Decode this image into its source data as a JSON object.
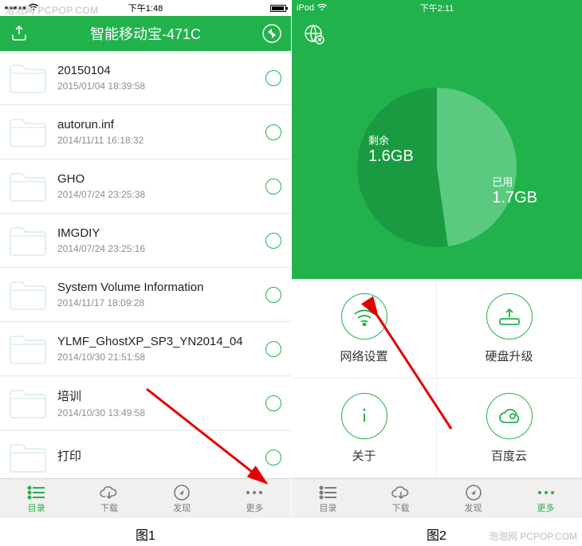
{
  "watermark": "泡泡网 PCPOP.COM",
  "screen1": {
    "status": {
      "carrier_dots": 5,
      "wifi": true,
      "time": "下午1:48",
      "battery": true
    },
    "nav": {
      "title": "智能移动宝-471C",
      "left_icon": "upload-icon",
      "right_icon": "refresh-arrows-icon"
    },
    "files": [
      {
        "name": "20150104",
        "date": "2015/01/04 18:39:58"
      },
      {
        "name": "autorun.inf",
        "date": "2014/11/11 16:18:32"
      },
      {
        "name": "GHO",
        "date": "2014/07/24 23:25:38"
      },
      {
        "name": "IMGDIY",
        "date": "2014/07/24 23:25:16"
      },
      {
        "name": "System Volume Information",
        "date": "2014/11/17 18:09:28"
      },
      {
        "name": "YLMF_GhostXP_SP3_YN2014_04",
        "date": "2014/10/30 21:51:58"
      },
      {
        "name": "培训",
        "date": "2014/10/30 13:49:58"
      },
      {
        "name": "打印",
        "date": ""
      }
    ],
    "tabs": [
      {
        "label": "目录",
        "icon": "list-icon",
        "active": true
      },
      {
        "label": "下载",
        "icon": "cloud-down-icon",
        "active": false
      },
      {
        "label": "发现",
        "icon": "compass-icon",
        "active": false
      },
      {
        "label": "更多",
        "icon": "dots-icon",
        "active": false
      }
    ],
    "caption": "图1"
  },
  "screen2": {
    "status": {
      "device": "iPod",
      "wifi": true,
      "time": "下午2:11"
    },
    "nav": {
      "icon": "globe-x-icon"
    },
    "storage": {
      "free_label": "剩余",
      "free_value": "1.6GB",
      "used_label": "已用",
      "used_value": "1.7GB"
    },
    "menu": [
      {
        "label": "网络设置",
        "icon": "wifi-icon"
      },
      {
        "label": "硬盘升级",
        "icon": "disk-up-icon"
      },
      {
        "label": "关于",
        "icon": "info-icon"
      },
      {
        "label": "百度云",
        "icon": "cloud-icon"
      }
    ],
    "tabs": [
      {
        "label": "目录",
        "icon": "list-icon",
        "active": false
      },
      {
        "label": "下载",
        "icon": "cloud-down-icon",
        "active": false
      },
      {
        "label": "发现",
        "icon": "compass-icon",
        "active": false
      },
      {
        "label": "更多",
        "icon": "dots-icon",
        "active": true
      }
    ],
    "caption": "图2"
  },
  "chart_data": {
    "type": "pie",
    "title": "Storage",
    "categories": [
      "剩余",
      "已用"
    ],
    "series": [
      {
        "name": "GB",
        "values": [
          1.6,
          1.7
        ]
      }
    ]
  }
}
